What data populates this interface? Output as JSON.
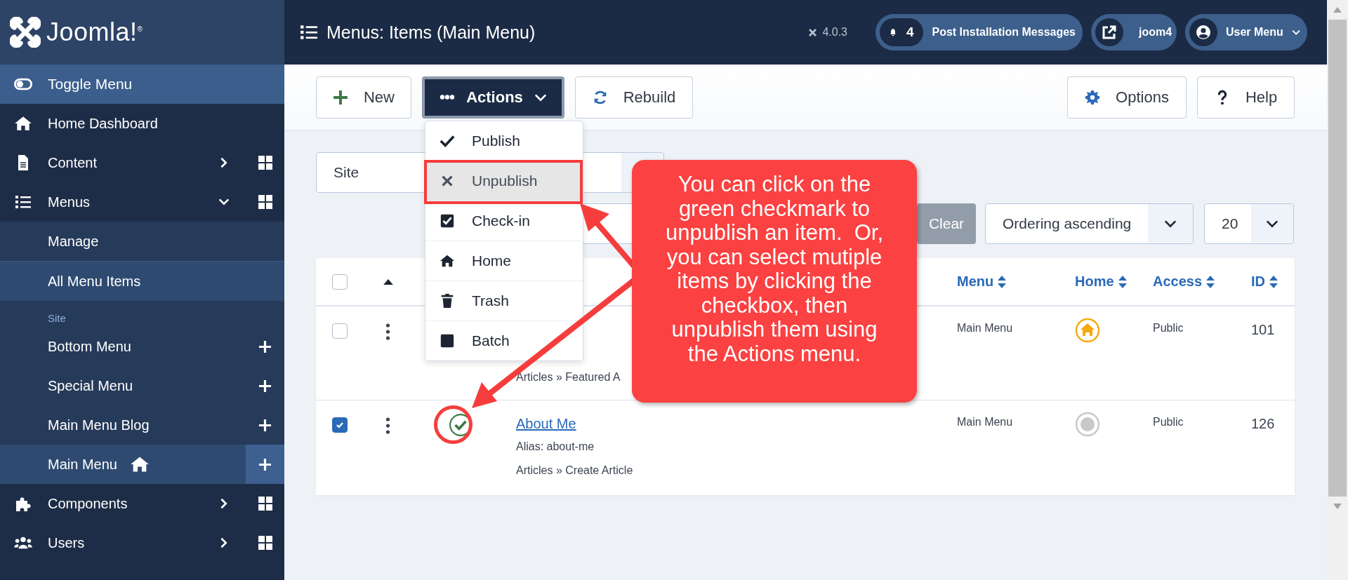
{
  "logo": {
    "text": "Joomla!$^{®}$"
  },
  "sidebar": {
    "toggle": "Toggle Menu",
    "items": [
      {
        "label": "Home Dashboard",
        "kind": "link"
      },
      {
        "label": "Content",
        "kind": "group",
        "expanded": false
      },
      {
        "label": "Menus",
        "kind": "group",
        "expanded": true,
        "children": [
          {
            "label": "Manage",
            "kind": "link",
            "selected": false
          },
          {
            "label": "All Menu Items",
            "kind": "link",
            "selected": true
          },
          {
            "label": "Site",
            "kind": "heading"
          },
          {
            "label": "Bottom Menu",
            "kind": "menu",
            "selected": false,
            "home": false
          },
          {
            "label": "Special Menu",
            "kind": "menu",
            "selected": false,
            "home": false
          },
          {
            "label": "Main Menu Blog",
            "kind": "menu",
            "selected": false,
            "home": false
          },
          {
            "label": "Main Menu",
            "kind": "menu",
            "selected": true,
            "home": true
          }
        ]
      },
      {
        "label": "Components",
        "kind": "group",
        "expanded": false
      },
      {
        "label": "Users",
        "kind": "group",
        "expanded": false
      }
    ]
  },
  "header": {
    "title": "Menus: Items (Main Menu)",
    "version": "4.0.3",
    "messages_count": "4",
    "messages_label": "Post Installation Messages",
    "site_label": "joom4",
    "user_label": "User Menu"
  },
  "toolbar": {
    "left": [
      "New",
      "Actions",
      "Rebuild"
    ],
    "right": [
      "Options",
      "Help"
    ]
  },
  "actions_menu": [
    {
      "label": "Publish",
      "selected": false
    },
    {
      "label": "Unpublish",
      "selected": true
    },
    {
      "label": "Check-in",
      "selected": false
    },
    {
      "label": "Home",
      "selected": false
    },
    {
      "label": "Trash",
      "selected": false
    },
    {
      "label": "Batch",
      "selected": false
    }
  ],
  "filters": {
    "site": "Site",
    "clear": "Clear",
    "ordering": "Ordering ascending",
    "limit": "20"
  },
  "table": {
    "select_all": {
      "checked": false
    },
    "columns": [
      "Menu",
      "Home",
      "Access",
      "ID"
    ],
    "rows": [
      {
        "checked": false,
        "breadcrumb": "Articles » Featured A",
        "menu": "Main Menu",
        "home": true,
        "access": "Public",
        "id": "101"
      },
      {
        "checked": true,
        "published": true,
        "title": "About Me",
        "alias": "Alias: about-me",
        "breadcrumb": "Articles » Create Article",
        "menu": "Main Menu",
        "home": false,
        "access": "Public",
        "id": "126"
      }
    ]
  },
  "callout": {
    "text": "You can click on the green checkmark to unpublish an item.  Or, you can select mutiple items by clicking the checkbox, then unpublish them using the Actions menu."
  }
}
